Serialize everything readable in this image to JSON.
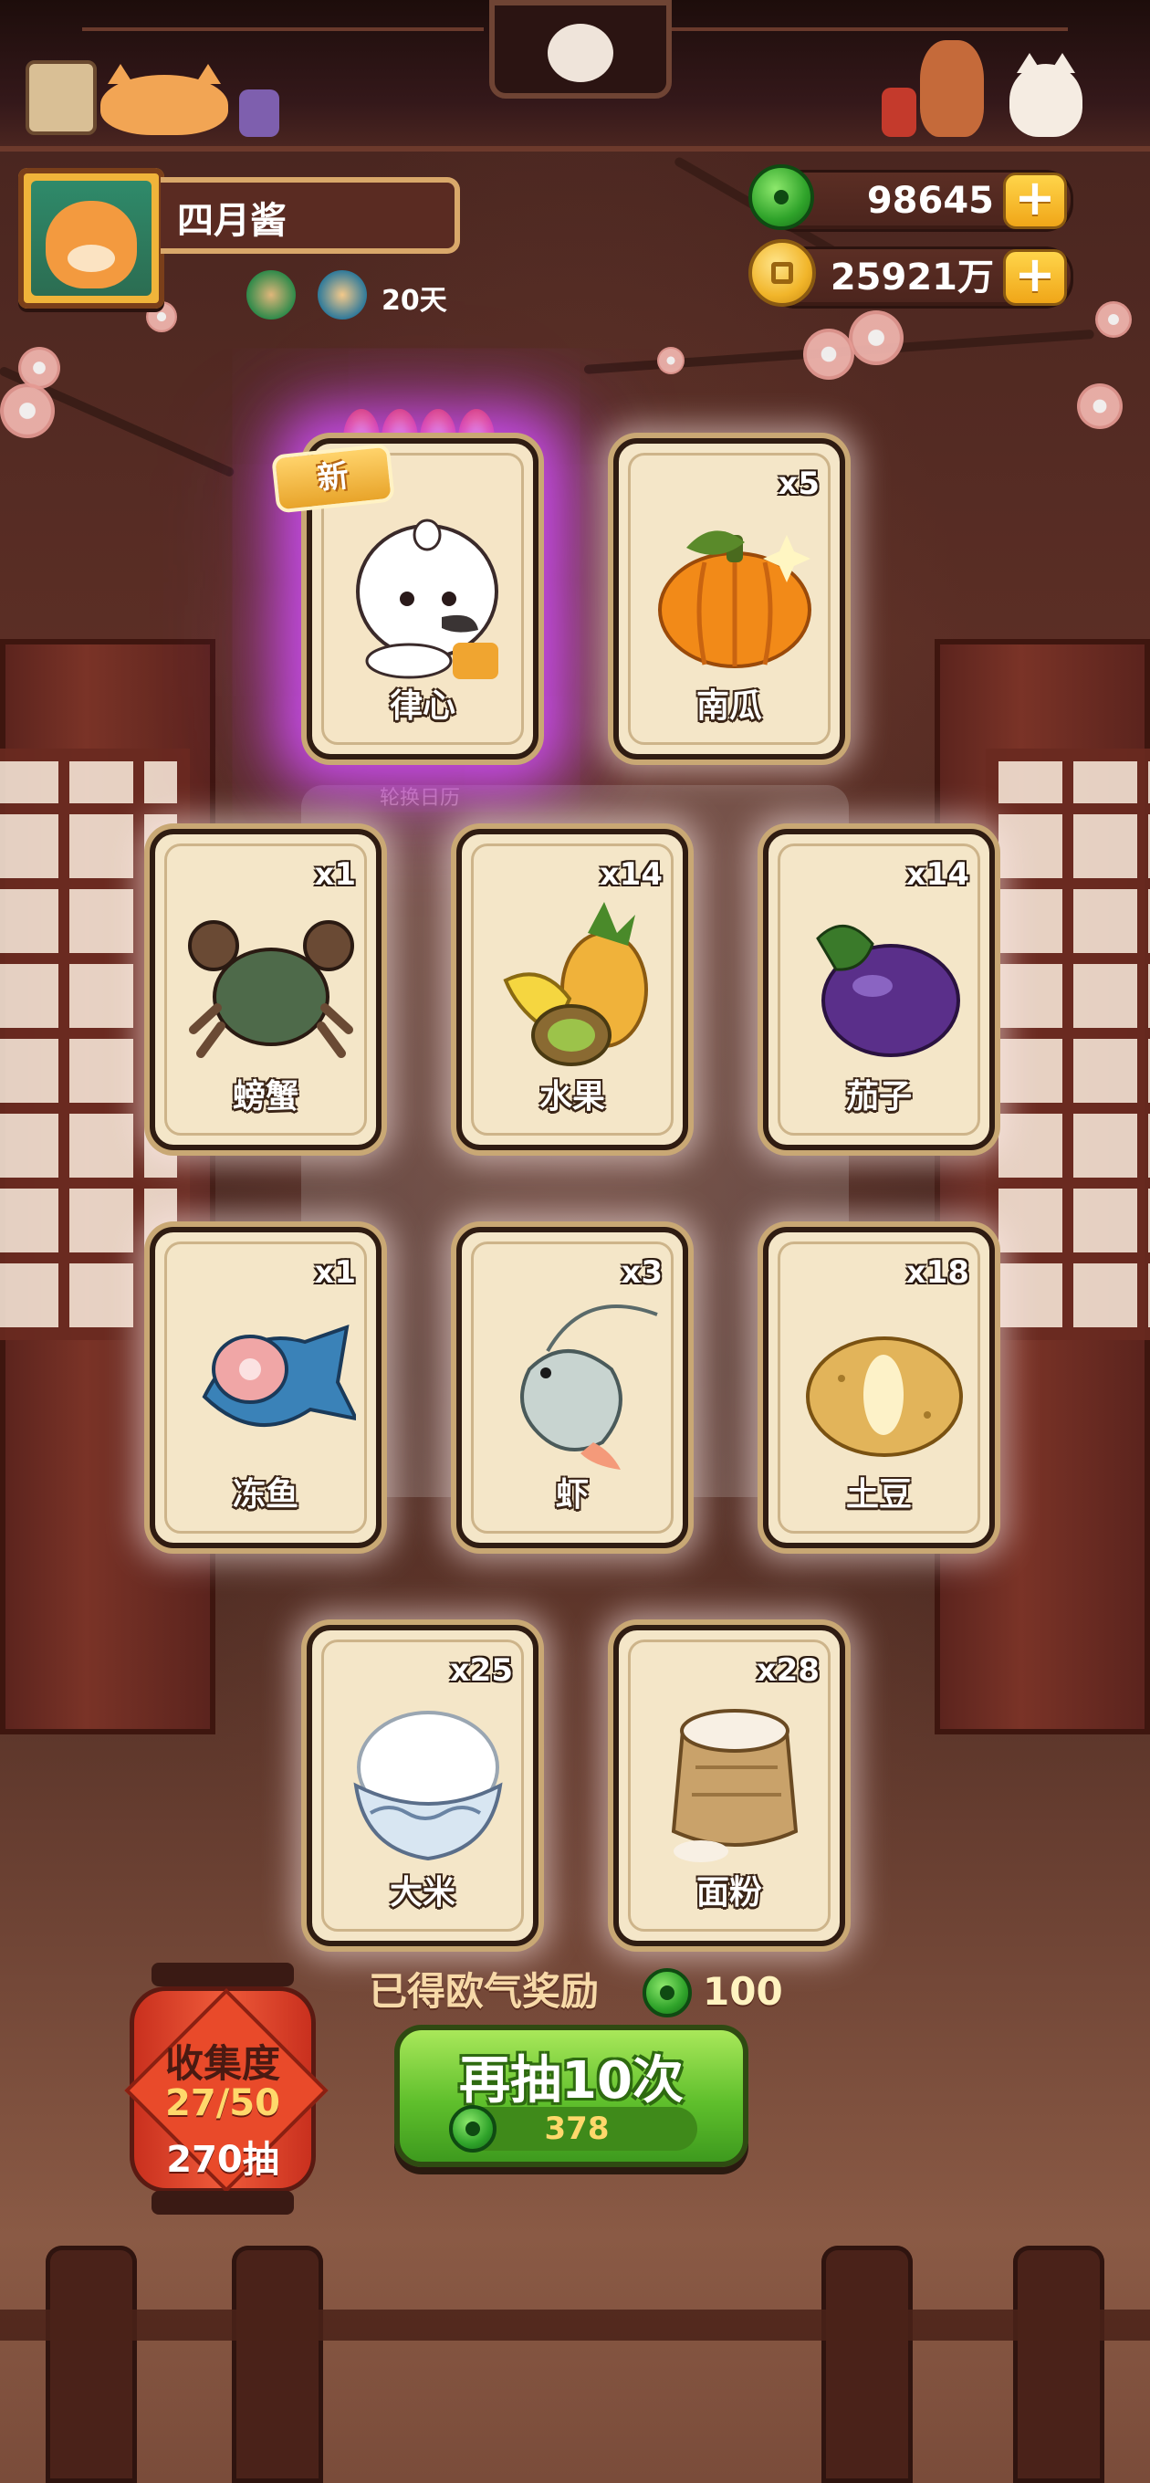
{
  "profile": {
    "name": "四月酱",
    "days": "20天"
  },
  "currency": {
    "jade": "98645",
    "gold": "25921万"
  },
  "featured": {
    "badge": "新",
    "rotate_label": "轮换日历"
  },
  "cards": [
    {
      "id": "lvxin",
      "title": "律心",
      "count": "",
      "rare": true,
      "icon": "duck-character"
    },
    {
      "id": "pumpkin",
      "title": "南瓜",
      "count": "x5",
      "icon": "pumpkin"
    },
    {
      "id": "crab",
      "title": "螃蟹",
      "count": "x1",
      "icon": "crab"
    },
    {
      "id": "fruit",
      "title": "水果",
      "count": "x14",
      "icon": "fruit"
    },
    {
      "id": "eggplant",
      "title": "茄子",
      "count": "x14",
      "icon": "eggplant"
    },
    {
      "id": "fish",
      "title": "冻鱼",
      "count": "x1",
      "icon": "frozen-fish"
    },
    {
      "id": "shrimp",
      "title": "虾",
      "count": "x3",
      "icon": "shrimp"
    },
    {
      "id": "potato",
      "title": "土豆",
      "count": "x18",
      "icon": "potato"
    },
    {
      "id": "rice",
      "title": "大米",
      "count": "x25",
      "icon": "rice-bowl"
    },
    {
      "id": "flour",
      "title": "面粉",
      "count": "x28",
      "icon": "flour-sack"
    }
  ],
  "reward": {
    "label": "已得欧气奖励",
    "amount": "100"
  },
  "collection": {
    "title": "收集度",
    "progress": "27/50",
    "draws": "270抽"
  },
  "draw": {
    "label": "再抽10次",
    "cost": "378"
  },
  "colors": {
    "accent_green": "#5fbf2c",
    "gold": "#f0a618",
    "rare_glow": "#d250ff"
  }
}
